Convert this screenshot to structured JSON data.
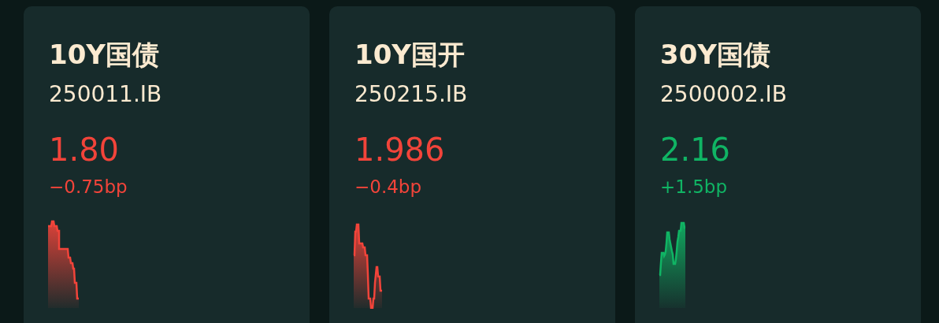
{
  "cards": [
    {
      "name": "10Y国债",
      "code": "250011.IB",
      "value": "1.80",
      "change": "−0.75bp",
      "color": "#f2443a"
    },
    {
      "name": "10Y国开",
      "code": "250215.IB",
      "value": "1.986",
      "change": "−0.4bp",
      "color": "#f2443a"
    },
    {
      "name": "30Y国债",
      "code": "2500002.IB",
      "value": "2.16",
      "change": "+1.5bp",
      "color": "#10b464"
    }
  ]
}
